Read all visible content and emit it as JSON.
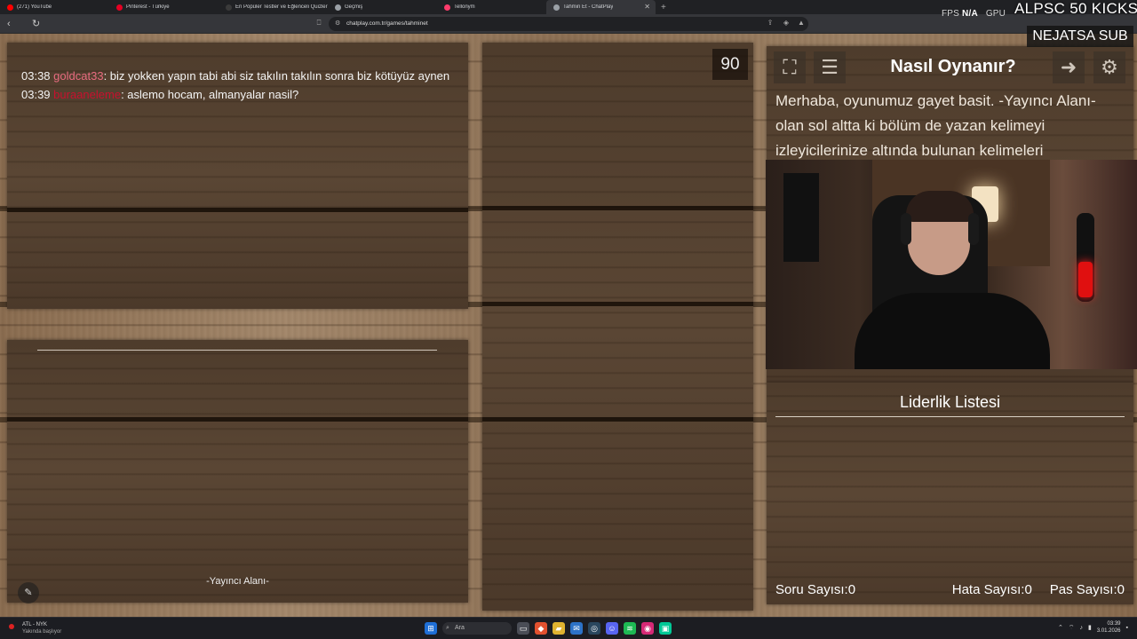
{
  "browser": {
    "tabs": [
      {
        "title": "(271) YouTube",
        "color": "#ff0000",
        "active": false
      },
      {
        "title": "Pinterest - Türkiye",
        "color": "#e60023",
        "active": false
      },
      {
        "title": "En Popüler Testler ve Eğlenceli Quizler",
        "color": "#3a3a3a",
        "active": false
      },
      {
        "title": "Geçmiş",
        "color": "#9aa0a6",
        "active": false
      },
      {
        "title": "Tellonym",
        "color": "#ff3b6b",
        "active": false
      },
      {
        "title": "Tahmin Et - ChatPlay",
        "color": "#9aa0a6",
        "active": true
      }
    ],
    "new_tab": "+",
    "url": "chatplay.com.tr/games/tahminet"
  },
  "stream_overlay": {
    "fps_label": "FPS",
    "fps_value": "N/A",
    "gpu_label": "GPU",
    "alert_title": "ALPSC 50 KICKS",
    "alert_badge": "NEJATSA SUB"
  },
  "chat": {
    "messages": [
      {
        "time": "03:38",
        "user": "goldcat33",
        "text": ": biz yokken yapın tabi abi siz takılın takılın sonra biz kötüyüz aynen"
      },
      {
        "time": "03:39",
        "user": "buraaneleme",
        "text": ": aslemo hocam, almanyalar nasil?"
      }
    ]
  },
  "streamer_area": {
    "label": "-Yayıncı Alanı-",
    "pen_icon": "pencil-icon"
  },
  "word_panel": {
    "timer": "90"
  },
  "how_to": {
    "title": "Nasıl Oynanır?",
    "text": "Merhaba, oyunumuz gayet basit. -Yayıncı Alanı- olan sol altta ki bölüm de yazan kelimeyi izleyicilerinize altında bulunan kelimeleri",
    "buttons": [
      "fullscreen-icon",
      "notes-icon",
      "exit-icon",
      "settings-icon"
    ]
  },
  "leaderboard": {
    "title": "Liderlik Listesi",
    "questions_label": "Soru Sayısı:",
    "questions_value": "0",
    "errors_label": "Hata Sayısı:",
    "errors_value": "0",
    "passes_label": "Pas Sayısı:",
    "passes_value": "0"
  },
  "taskbar": {
    "weather_title": "ATL - NYK",
    "weather_sub": "Yakında başlıyor",
    "search_placeholder": "Ara",
    "time": "03:39",
    "date": "3.01.2026"
  }
}
